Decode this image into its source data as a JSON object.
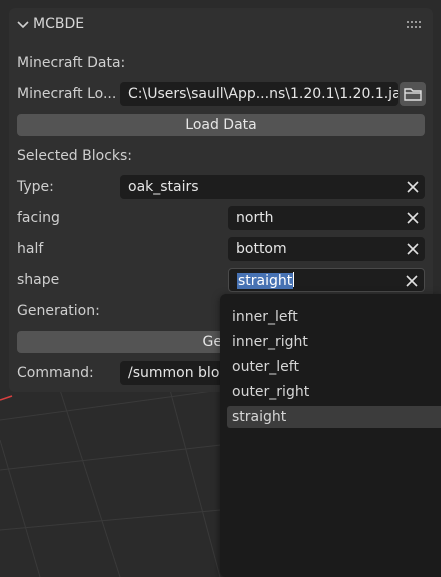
{
  "panel": {
    "title": "MCBDE",
    "minecraft_data_heading": "Minecraft Data:",
    "minecraft_location_label": "Minecraft Lo...",
    "minecraft_location_value": "C:\\Users\\saull\\App...ns\\1.20.1\\1.20.1.jar",
    "load_data_button": "Load Data",
    "selected_blocks_heading": "Selected Blocks:",
    "type_label": "Type:",
    "type_value": "oak_stairs",
    "properties": [
      {
        "label": "facing",
        "value": "north"
      },
      {
        "label": "half",
        "value": "bottom"
      },
      {
        "label": "shape",
        "value": "straight"
      }
    ],
    "generation_heading": "Generation:",
    "generate_button": "Gene",
    "command_label": "Command:",
    "command_value": "/summon bloc"
  },
  "dropdown": {
    "options": [
      "inner_left",
      "inner_right",
      "outer_left",
      "outer_right",
      "straight"
    ],
    "active": "straight"
  },
  "colors": {
    "panel_bg": "#303030",
    "field_bg": "#1d1d1d",
    "button_bg": "#545454",
    "selection": "#4772b3",
    "accent_red": "#d94040"
  },
  "icons": [
    "chevron-down-icon",
    "drag-handle-icon",
    "folder-icon",
    "clear-x-icon"
  ]
}
